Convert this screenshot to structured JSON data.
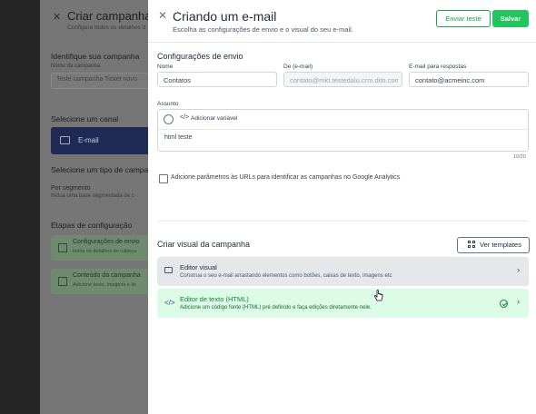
{
  "background": {
    "title": "Criar campanha",
    "subtitle": "Configure todos os detalhes d",
    "identify_label": "Identifique sua campanha",
    "campaign_name_label": "Nome da campanha",
    "campaign_name_value": "Teste campanha Ticket novo",
    "channel_label": "Selecione um canal",
    "channel_value": "E-mail",
    "type_label": "Selecione um tipo de campan",
    "segment_title": "Por segmento",
    "segment_desc": "Inclua uma base segmentada de c",
    "steps_label": "Etapas de configuração",
    "steps": [
      {
        "title": "Configurações de envio",
        "desc": "Insira os detalhes do cabeça"
      },
      {
        "title": "Conteúdo da campanha",
        "desc": "Adicione texto, imagens e lin"
      }
    ]
  },
  "header": {
    "title": "Criando um e-mail",
    "subtitle": "Escolha as configurações de envio e o visual do seu e-mail.",
    "test_button": "Enviar teste",
    "save_button": "Salvar"
  },
  "send_settings": {
    "title": "Configurações de envio",
    "name_label": "Nome",
    "name_value": "Contatos",
    "from_label": "De (e-mail)",
    "from_value": "contato@mkt.testedalu.crm.dito.com.b",
    "reply_label": "E-mail para respostas",
    "reply_value": "contato@acmeinc.com",
    "subject_label": "Assunto",
    "add_variable": "Adicionar variável",
    "subject_text": "html teste",
    "counter": "10/20",
    "ga_checkbox_label": "Adicione parâmetros às URLs para identificar as campanhas no Google Analytics",
    "ga_checked": false
  },
  "visual": {
    "title": "Criar visual da campanha",
    "templates_button": "Ver templates",
    "options": [
      {
        "title": "Editor visual",
        "desc": "Construa o seu e-mail arrastando elementos como botões, caixas de texto, imagens etc"
      },
      {
        "title": "Editor de texto (HTML)",
        "desc": "Adicione um código fonte (HTML) pré definido e faça edições diretamente nele.",
        "selected": true
      }
    ]
  },
  "colors": {
    "accent_green": "#22c55e",
    "selected_bg": "#dcfce7",
    "channel_navy": "#1f2a55"
  }
}
